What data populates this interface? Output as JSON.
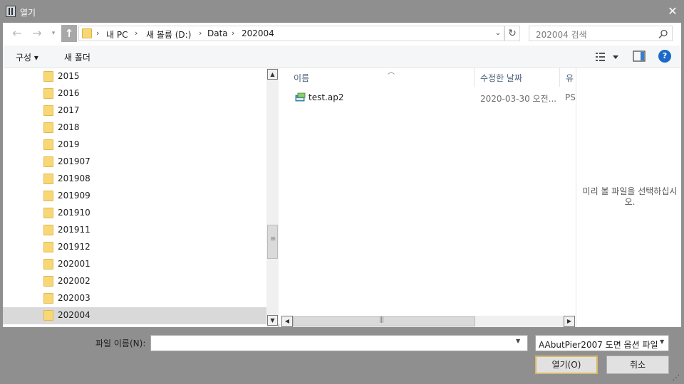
{
  "window": {
    "title": "열기",
    "close_icon": "close-icon",
    "app_icon": "app-icon"
  },
  "navigation": {
    "back_icon": "arrow-left-icon",
    "forward_icon": "arrow-right-icon",
    "recent_icon": "chevron-down-icon",
    "up_icon": "arrow-up-icon"
  },
  "address": {
    "crumbs": [
      "내 PC",
      "새 볼륨 (D:)",
      "Data",
      "202004"
    ],
    "separator": "›"
  },
  "search": {
    "placeholder": "202004 검색"
  },
  "commandbar": {
    "organize_label": "구성 ▾",
    "new_folder_label": "새 폴더"
  },
  "nav_tree": {
    "items": [
      {
        "label": "2015"
      },
      {
        "label": "2016"
      },
      {
        "label": "2017"
      },
      {
        "label": "2018"
      },
      {
        "label": "2019"
      },
      {
        "label": "201907"
      },
      {
        "label": "201908"
      },
      {
        "label": "201909"
      },
      {
        "label": "201910"
      },
      {
        "label": "201911"
      },
      {
        "label": "201912"
      },
      {
        "label": "202001"
      },
      {
        "label": "202002"
      },
      {
        "label": "202003"
      },
      {
        "label": "202004",
        "selected": true
      }
    ]
  },
  "file_list": {
    "columns": [
      "이름",
      "수정한 날짜",
      "유"
    ],
    "files": [
      {
        "name": "test.ap2",
        "modified": "2020-03-30 오전...",
        "type": "PS"
      }
    ]
  },
  "preview": {
    "message": "미리 볼 파일을 선택하십시오."
  },
  "bottom": {
    "filename_label": "파일 이름(N):",
    "filename_value": "",
    "filetype_value": "AAbutPier2007 도면 옵션 파일",
    "open_label": "열기(O)",
    "cancel_label": "취소"
  },
  "colors": {
    "titlebar": "#8f8f8f",
    "selected_row": "#d9d9d9",
    "folder": "#f8d775",
    "help": "#1b6ac9"
  }
}
